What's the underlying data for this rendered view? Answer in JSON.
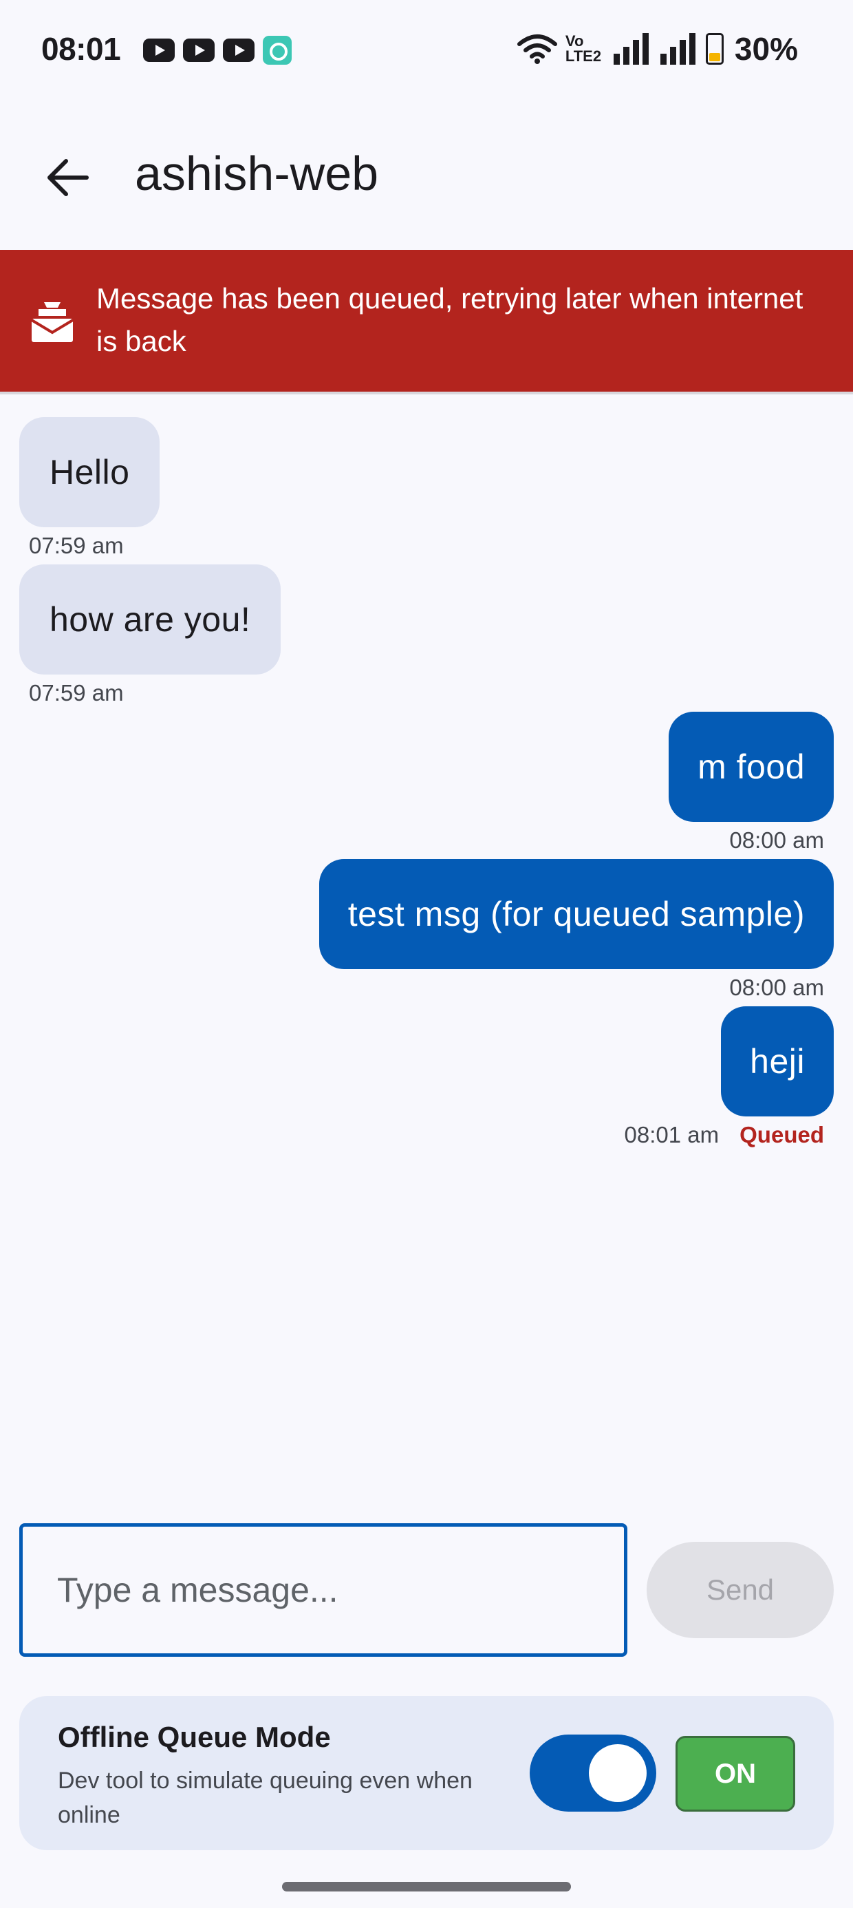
{
  "status_bar": {
    "time": "08:01",
    "battery": "30%",
    "network_label": "Vo LTE2",
    "notification_icons": [
      "youtube-icon",
      "youtube-icon",
      "youtube-icon",
      "app-icon"
    ],
    "system_icons": [
      "wifi-icon",
      "signal-icon",
      "signal-icon",
      "battery-icon"
    ]
  },
  "app_bar": {
    "title": "ashish-web",
    "back_icon": "arrow-left-icon"
  },
  "banner": {
    "icon": "mail-stack-icon",
    "text": "Message has been queued, retrying later when internet is back",
    "color": "#b3241e"
  },
  "messages": [
    {
      "direction": "in",
      "text": "Hello",
      "time": "07:59 am"
    },
    {
      "direction": "in",
      "text": "how are you!",
      "time": "07:59 am"
    },
    {
      "direction": "out",
      "text": "m food",
      "time": "08:00 am"
    },
    {
      "direction": "out",
      "text": "test msg (for queued sample)",
      "time": "08:00 am"
    },
    {
      "direction": "out",
      "text": "heji",
      "time": "08:01 am",
      "status": "Queued"
    }
  ],
  "composer": {
    "placeholder": "Type a message...",
    "value": "",
    "send_label": "Send"
  },
  "offline_mode": {
    "title": "Offline Queue Mode",
    "description": "Dev tool to simulate queuing even when online",
    "toggle_on": true,
    "badge": "ON"
  },
  "colors": {
    "accent": "#045bb5",
    "banner": "#b3241e",
    "badge": "#4caf50"
  }
}
